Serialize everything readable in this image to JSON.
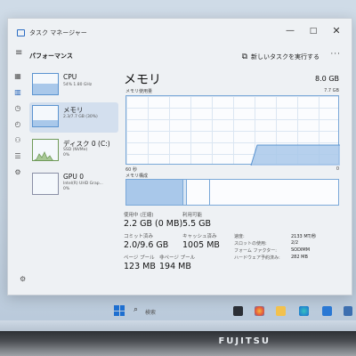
{
  "window": {
    "title": "タスク マネージャー",
    "page_title": "パフォーマンス",
    "run_task_label": "新しいタスクを実行する",
    "controls": {
      "minimize": "—",
      "maximize": "□",
      "close": "✕"
    }
  },
  "devices": [
    {
      "name": "CPU",
      "sub": "54% 1.80 GHz",
      "usage": 0.54
    },
    {
      "name": "メモリ",
      "sub": "2.3/7.7 GB (30%)",
      "usage": 0.3
    },
    {
      "name": "ディスク 0 (C:)",
      "sub1": "SSD (NVMe)",
      "sub2": "0%",
      "usage": 0.0
    },
    {
      "name": "GPU 0",
      "sub1": "Intel(R) UHD Grap...",
      "sub2": "0%",
      "usage": 0.0
    }
  ],
  "main": {
    "title": "メモリ",
    "total": "8.0 GB",
    "graph_label": "メモリ使用量",
    "graph_max": "7.7 GB",
    "axis_left": "60 秒",
    "axis_right": "0",
    "composition_label": "メモリ構成",
    "stats": {
      "in_use_label": "使用中 (圧縮)",
      "in_use_value": "2.2 GB (0 MB)",
      "available_label": "利用可能",
      "available_value": "5.5 GB",
      "committed_label": "コミット済み",
      "committed_value": "2.0/9.6 GB",
      "cached_label": "キャッシュ済み",
      "cached_value": "1005 MB",
      "paged_label": "ページ プール",
      "paged_value": "123 MB",
      "nonpaged_label": "非ページ プール",
      "nonpaged_value": "194 MB"
    },
    "specs": [
      {
        "k": "速度:",
        "v": "2133 MT/秒"
      },
      {
        "k": "スロットの使用:",
        "v": "2/2"
      },
      {
        "k": "フォーム ファクター:",
        "v": "SODIMM"
      },
      {
        "k": "ハードウェア予約済み:",
        "v": "282 MB"
      }
    ],
    "graph_usage_fraction": 0.3
  },
  "taskbar": {
    "search_label": "検索"
  },
  "laptop_brand": "FUJITSU",
  "colors": {
    "accent": "#1e6fd0",
    "memory_line": "#5a93d0",
    "memory_fill": "#a9c8ea"
  }
}
